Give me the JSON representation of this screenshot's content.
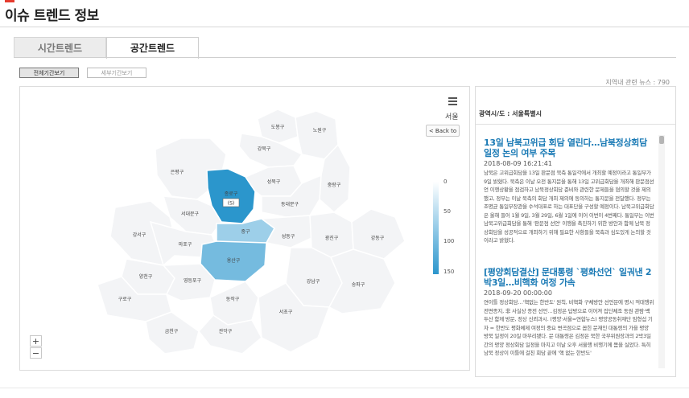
{
  "page": {
    "title": "이슈 트렌드 정보"
  },
  "tabs": [
    {
      "label": "시간트렌드",
      "active": false
    },
    {
      "label": "공간트렌드",
      "active": true
    }
  ],
  "period_buttons": {
    "all": "전체기간보기",
    "detail": "세부기간보기"
  },
  "news_count": "지역내 관련 뉴스 : 790",
  "map": {
    "city_label": "서울",
    "back_label": "< Back to",
    "zoom_in": "+",
    "zoom_out": "−",
    "scale": {
      "ticks": [
        "0",
        "50",
        "100",
        "150"
      ],
      "min_color": "#ffffff",
      "max_color": "#2b96cc"
    },
    "highlight_label": "(S)",
    "districts": [
      {
        "name": "도봉구",
        "value": 0
      },
      {
        "name": "노원구",
        "value": 0
      },
      {
        "name": "강북구",
        "value": 0
      },
      {
        "name": "은평구",
        "value": 0
      },
      {
        "name": "종로구",
        "value": 160
      },
      {
        "name": "성북구",
        "value": 0
      },
      {
        "name": "중랑구",
        "value": 0
      },
      {
        "name": "서대문구",
        "value": 0
      },
      {
        "name": "동대문구",
        "value": 0
      },
      {
        "name": "강서구",
        "value": 0
      },
      {
        "name": "마포구",
        "value": 0
      },
      {
        "name": "중구",
        "value": 50
      },
      {
        "name": "성동구",
        "value": 0
      },
      {
        "name": "광진구",
        "value": 0
      },
      {
        "name": "강동구",
        "value": 0
      },
      {
        "name": "용산구",
        "value": 85
      },
      {
        "name": "양천구",
        "value": 0
      },
      {
        "name": "영등포구",
        "value": 0
      },
      {
        "name": "구로구",
        "value": 0
      },
      {
        "name": "동작구",
        "value": 0
      },
      {
        "name": "강남구",
        "value": 0
      },
      {
        "name": "송파구",
        "value": 0
      },
      {
        "name": "서초구",
        "value": 0
      },
      {
        "name": "관악구",
        "value": 0
      },
      {
        "name": "금천구",
        "value": 0
      }
    ]
  },
  "news": {
    "region_label": "광역시/도 : 서울특별시",
    "articles": [
      {
        "headline": "13일 남북고위급 회담 열린다…남북정상회담 일정 논의 여부 주목",
        "date": "2018-08-09 16:21:41",
        "body": "남북은 고위급회담을 13일 판문점 북측 통일각에서 개최할 예정이라고 통일부가 9일 밝혔다. 북측은 이날 오전 통지문을 통해 13일 고위급회담을 개최해 판문점선언 이행상황을 점검하고 남북정상회담 준비와 관련한 문제들을 협의할 것을 제의했고, 정부는 이날 북측의 회담 개최 제의에 동의하는 통지문을 전달했다. 정부는 조명균 통일부장관을 수석대표로 하는 대표단을 구성할 예정이다. 남북고위급회담은 올해 들어 1월 9일, 3월 29일, 6월 1일에 이어 이번이 4번째다. 통일부는 이번 남북고위급회담을 통해 '판문점 선언' 이행을 촉진하기 위한 방안과 함께 남북 정상회담을 성공적으로 개최하기 위해 필요한 사항들을 북측과 심도있게 논의할 것이라고 밝혔다."
      },
      {
        "headline": "[평양회담결산] 문대통령 `평화선언` 일궈낸 2박3일…비핵화 여정 가속",
        "date": "2018-09-20 00:00:00",
        "body": "연이틀 정상회담…'핵없는 한반도' 원칙, 비핵화 구체방안 선언문에 명시 적대행위 전면종지, 非 사실상 종전 선언…김정은 답방으로 이어져 집단체조 동원 관람·백두산 함께 방문, 정상 신뢰과시. (평양·서울=연합뉴스) 평양공동취재단 임형섭 기자 = 한반도 평화체제 여정의 중요 변곡점으로 꼽힌 문재인 대통령의 가을 평양 방북 일정이 20일 마무리됐다. 문 대통령은 김정은 북한 국무위원장과의 2박3일간의 평양 정상회담 일정을 마치고 이날 오후 서울행 비행기에 몸을 실었다. 특히 남북 정상이 이틀에 걸친 회담 끝에 '핵 없는 한반도'"
      }
    ]
  }
}
